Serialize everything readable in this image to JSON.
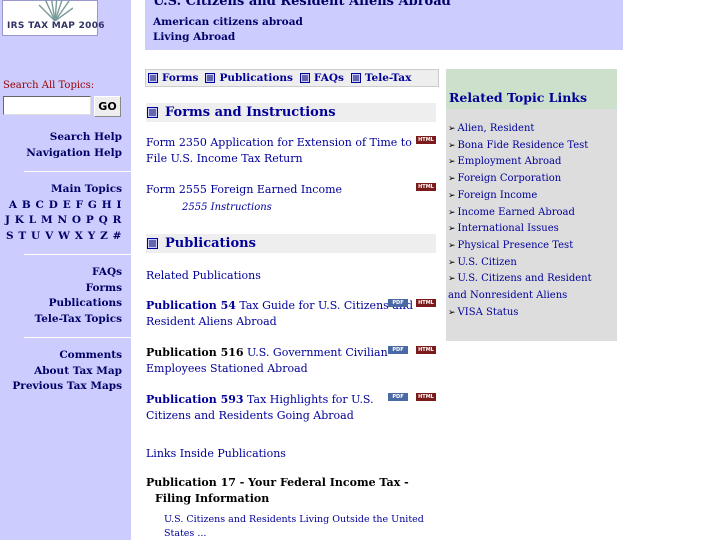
{
  "sidebar": {
    "logo_text": "IRS TAX MAP 2006",
    "search_label": "Search All Topics:",
    "search_value": "",
    "go_label": "GO",
    "help_links": [
      "Search Help",
      "Navigation Help"
    ],
    "main_topics_label": "Main Topics",
    "alphabet_rows": [
      "A B C D E F G H I",
      "J K L M N O P Q R",
      "S T U V W X Y Z #"
    ],
    "resource_links": [
      "FAQs",
      "Forms",
      "Publications",
      "Tele-Tax Topics"
    ],
    "info_links": [
      "Comments",
      "About Tax Map",
      "Previous Tax Maps"
    ]
  },
  "header": {
    "title": "U.S. Citizens and Resident Aliens Abroad",
    "line1": "American citizens abroad",
    "line2": "Living Abroad"
  },
  "tabs": [
    "Forms",
    "Publications",
    "FAQs",
    "Tele-Tax"
  ],
  "forms_section": {
    "heading": "Forms and Instructions",
    "form1": {
      "number": "Form 2350",
      "title": " Application for Extension of Time to File U.S. Income Tax Return"
    },
    "form2": {
      "number": "Form 2555",
      "title": " Foreign Earned Income"
    },
    "form2_instructions": "2555 Instructions"
  },
  "publications_section": {
    "heading": "Publications",
    "related_label": "Related Publications",
    "pub1": {
      "number": "Publication 54",
      "title": " Tax Guide for U.S. Citizens and Resident Aliens Abroad"
    },
    "pub2": {
      "number": "Publication 516",
      "title": " U.S. Government Civilian Employees Stationed Abroad"
    },
    "pub3": {
      "number": "Publication 593",
      "title": " Tax Highlights for U.S. Citizens and Residents Going Abroad"
    },
    "links_inside_label": "Links Inside Publications",
    "pub17": {
      "line1": "Publication 17 - Your Federal Income Tax -",
      "line2": "Filing Information"
    },
    "pub17_desc": "U.S. Citizens and Residents Living Outside the United States ..."
  },
  "badges": {
    "pdf": "PDF",
    "html": "HTML"
  },
  "related_topics": {
    "heading": "Related Topic Links",
    "items": [
      "Alien, Resident",
      "Bona Fide Residence Test",
      "Employment Abroad",
      "Foreign Corporation",
      "Foreign Income",
      "Income Earned Abroad",
      "International Issues",
      "Physical Presence Test",
      "U.S. Citizen",
      "U.S. Citizens and Resident",
      "and Nonresident Aliens",
      "VISA Status"
    ]
  },
  "colors": {
    "sidebar_bg": "#ccccff",
    "link": "#000099",
    "panel_bg": "#dddddd",
    "panel_head": "#cce0cc"
  }
}
